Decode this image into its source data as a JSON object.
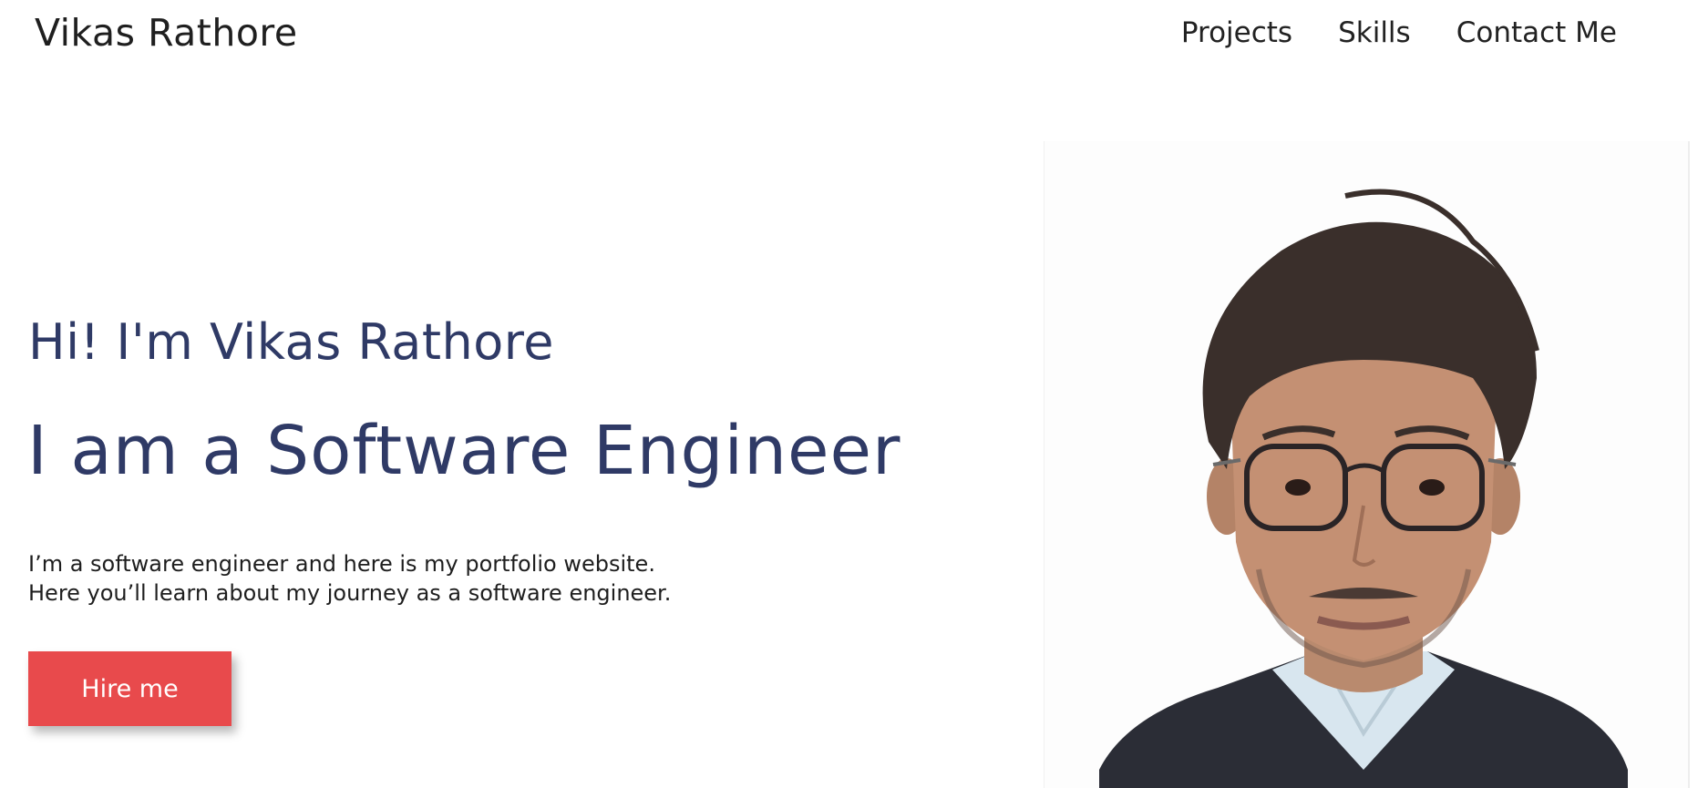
{
  "header": {
    "brand": "Vikas Rathore",
    "nav": [
      "Projects",
      "Skills",
      "Contact Me"
    ]
  },
  "hero": {
    "greeting": "Hi! I'm Vikas Rathore",
    "title": "I am a Software Engineer",
    "description": [
      "I’m a software engineer and here is my portfolio website.",
      "Here you’ll learn about my journey as a software engineer."
    ],
    "cta_label": "Hire me"
  },
  "colors": {
    "heading": "#2f3a66",
    "cta": "#e84a4c"
  }
}
